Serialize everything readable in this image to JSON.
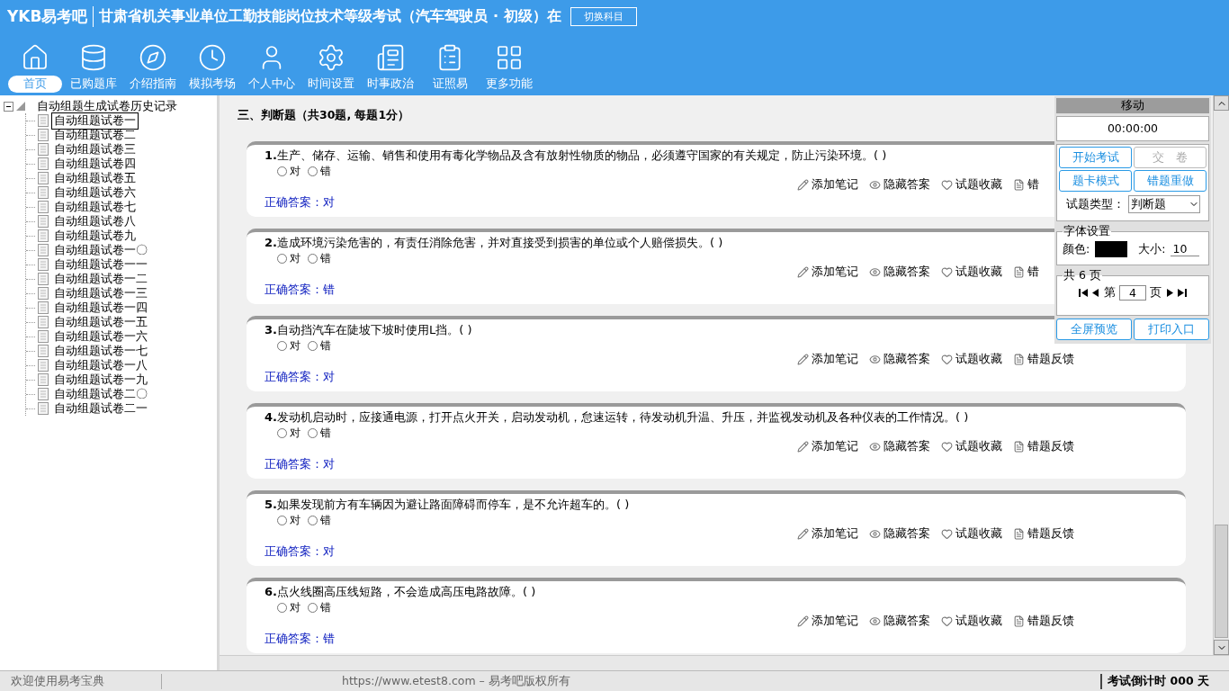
{
  "header": {
    "logo": "YKB易考吧",
    "title": "甘肃省机关事业单位工勤技能岗位技术等级考试（汽车驾驶员 · 初级）在",
    "switch_button": "切换科目"
  },
  "nav": [
    {
      "label": "首页",
      "selected": true
    },
    {
      "label": "已购题库",
      "selected": false
    },
    {
      "label": "介绍指南",
      "selected": false
    },
    {
      "label": "模拟考场",
      "selected": false
    },
    {
      "label": "个人中心",
      "selected": false
    },
    {
      "label": "时间设置",
      "selected": false
    },
    {
      "label": "时事政治",
      "selected": false
    },
    {
      "label": "证照易",
      "selected": false
    },
    {
      "label": "更多功能",
      "selected": false
    }
  ],
  "tree": {
    "label": "自动组题生成试卷历史记录",
    "expanded": true,
    "children": [
      {
        "label": "自动组题试卷一",
        "selected": true
      },
      {
        "label": "自动组题试卷二",
        "selected": false
      },
      {
        "label": "自动组题试卷三",
        "selected": false
      },
      {
        "label": "自动组题试卷四",
        "selected": false
      },
      {
        "label": "自动组题试卷五",
        "selected": false
      },
      {
        "label": "自动组题试卷六",
        "selected": false
      },
      {
        "label": "自动组题试卷七",
        "selected": false
      },
      {
        "label": "自动组题试卷八",
        "selected": false
      },
      {
        "label": "自动组题试卷九",
        "selected": false
      },
      {
        "label": "自动组题试卷一〇",
        "selected": false
      },
      {
        "label": "自动组题试卷一一",
        "selected": false
      },
      {
        "label": "自动组题试卷一二",
        "selected": false
      },
      {
        "label": "自动组题试卷一三",
        "selected": false
      },
      {
        "label": "自动组题试卷一四",
        "selected": false
      },
      {
        "label": "自动组题试卷一五",
        "selected": false
      },
      {
        "label": "自动组题试卷一六",
        "selected": false
      },
      {
        "label": "自动组题试卷一七",
        "selected": false
      },
      {
        "label": "自动组题试卷一八",
        "selected": false
      },
      {
        "label": "自动组题试卷一九",
        "selected": false
      },
      {
        "label": "自动组题试卷二〇",
        "selected": false
      },
      {
        "label": "自动组题试卷二一",
        "selected": false
      }
    ]
  },
  "section_title": "三、判断题（共30题, 每题1分）",
  "questions": [
    {
      "number": "1.",
      "text": "生产、储存、运输、销售和使用有毒化学物品及含有放射性物质的物品，必须遵守国家的有关规定，防止污染环境。( )",
      "options": [
        {
          "label": "对",
          "selected": false
        },
        {
          "label": "错",
          "selected": false
        }
      ],
      "actions": [
        {
          "kind": "note",
          "label": "添加笔记"
        },
        {
          "kind": "hide",
          "label": "隐藏答案"
        },
        {
          "kind": "favorite",
          "label": "试题收藏"
        },
        {
          "kind": "feedback",
          "label": "错"
        }
      ],
      "answer_label": "正确答案：",
      "answer": "对"
    },
    {
      "number": "2.",
      "text": "造成环境污染危害的，有责任消除危害，并对直接受到损害的单位或个人赔偿损失。( )",
      "options": [
        {
          "label": "对",
          "selected": false
        },
        {
          "label": "错",
          "selected": false
        }
      ],
      "actions": [
        {
          "kind": "note",
          "label": "添加笔记"
        },
        {
          "kind": "hide",
          "label": "隐藏答案"
        },
        {
          "kind": "favorite",
          "label": "试题收藏"
        },
        {
          "kind": "feedback",
          "label": "错"
        }
      ],
      "answer_label": "正确答案：",
      "answer": "错"
    },
    {
      "number": "3.",
      "text": "自动挡汽车在陡坡下坡时使用L挡。( )",
      "options": [
        {
          "label": "对",
          "selected": false
        },
        {
          "label": "错",
          "selected": false
        }
      ],
      "actions": [
        {
          "kind": "note",
          "label": "添加笔记"
        },
        {
          "kind": "hide",
          "label": "隐藏答案"
        },
        {
          "kind": "favorite",
          "label": "试题收藏"
        },
        {
          "kind": "feedback",
          "label": "错题反馈"
        }
      ],
      "answer_label": "正确答案：",
      "answer": "对"
    },
    {
      "number": "4.",
      "text": "发动机启动时，应接通电源，打开点火开关，启动发动机，怠速运转，待发动机升温、升压，并监视发动机及各种仪表的工作情况。( )",
      "options": [
        {
          "label": "对",
          "selected": false
        },
        {
          "label": "错",
          "selected": false
        }
      ],
      "actions": [
        {
          "kind": "note",
          "label": "添加笔记"
        },
        {
          "kind": "hide",
          "label": "隐藏答案"
        },
        {
          "kind": "favorite",
          "label": "试题收藏"
        },
        {
          "kind": "feedback",
          "label": "错题反馈"
        }
      ],
      "answer_label": "正确答案：",
      "answer": "对"
    },
    {
      "number": "5.",
      "text": "如果发现前方有车辆因为避让路面障碍而停车，是不允许超车的。( )",
      "options": [
        {
          "label": "对",
          "selected": false
        },
        {
          "label": "错",
          "selected": false
        }
      ],
      "actions": [
        {
          "kind": "note",
          "label": "添加笔记"
        },
        {
          "kind": "hide",
          "label": "隐藏答案"
        },
        {
          "kind": "favorite",
          "label": "试题收藏"
        },
        {
          "kind": "feedback",
          "label": "错题反馈"
        }
      ],
      "answer_label": "正确答案：",
      "answer": "对"
    },
    {
      "number": "6.",
      "text": "点火线圈高压线短路，不会造成高压电路故障。( )",
      "options": [
        {
          "label": "对",
          "selected": false
        },
        {
          "label": "错",
          "selected": false
        }
      ],
      "actions": [
        {
          "kind": "note",
          "label": "添加笔记"
        },
        {
          "kind": "hide",
          "label": "隐藏答案"
        },
        {
          "kind": "favorite",
          "label": "试题收藏"
        },
        {
          "kind": "feedback",
          "label": "错题反馈"
        }
      ],
      "answer_label": "正确答案：",
      "answer": "错"
    }
  ],
  "panel": {
    "title": "移动",
    "timer": "00:00:00",
    "buttons": [
      {
        "label": "开始考试",
        "disabled": false
      },
      {
        "label": "交　卷",
        "disabled": true
      },
      {
        "label": "题卡模式",
        "disabled": false
      },
      {
        "label": "错题重做",
        "disabled": false
      }
    ],
    "type_label": "试题类型：",
    "type_value": "判断题",
    "font_group": "字体设置",
    "color_label": "颜色:",
    "color": "#000000",
    "size_label": "大小:",
    "size": "10",
    "pages_group": "共 6 页",
    "page_prefix": "第",
    "page": "4",
    "page_suffix": "页",
    "bottom_buttons": [
      "全屏预览",
      "打印入口"
    ]
  },
  "status": {
    "welcome": "欢迎使用易考宝典",
    "copyright": "https://www.etest8.com – 易考吧版权所有",
    "countdown": "考试倒计时 000 天"
  }
}
